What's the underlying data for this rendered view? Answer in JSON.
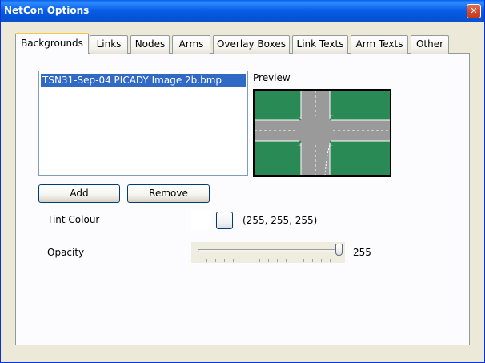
{
  "window": {
    "title": "NetCon Options",
    "close_glyph": "✕"
  },
  "tabs": [
    {
      "label": "Backgrounds",
      "active": true
    },
    {
      "label": "Links",
      "active": false
    },
    {
      "label": "Nodes",
      "active": false
    },
    {
      "label": "Arms",
      "active": false
    },
    {
      "label": "Overlay Boxes",
      "active": false
    },
    {
      "label": "Link Texts",
      "active": false
    },
    {
      "label": "Arm Texts",
      "active": false
    },
    {
      "label": "Other",
      "active": false
    }
  ],
  "backgrounds": {
    "files": [
      {
        "name": "TSN31-Sep-04 PICADY Image 2b.bmp",
        "selected": true
      }
    ],
    "preview_label": "Preview",
    "add_label": "Add",
    "remove_label": "Remove",
    "tint": {
      "label": "Tint Colour",
      "value_text": "(255, 255, 255)",
      "color": "#ffffff"
    },
    "opacity": {
      "label": "Opacity",
      "value_text": "255",
      "value": 255,
      "min": 0,
      "max": 255
    }
  },
  "colors": {
    "titlebar": "#0a5ee8",
    "selection": "#316ac5",
    "preview_grass": "#2a8a55",
    "preview_road": "#9a9a9a"
  }
}
